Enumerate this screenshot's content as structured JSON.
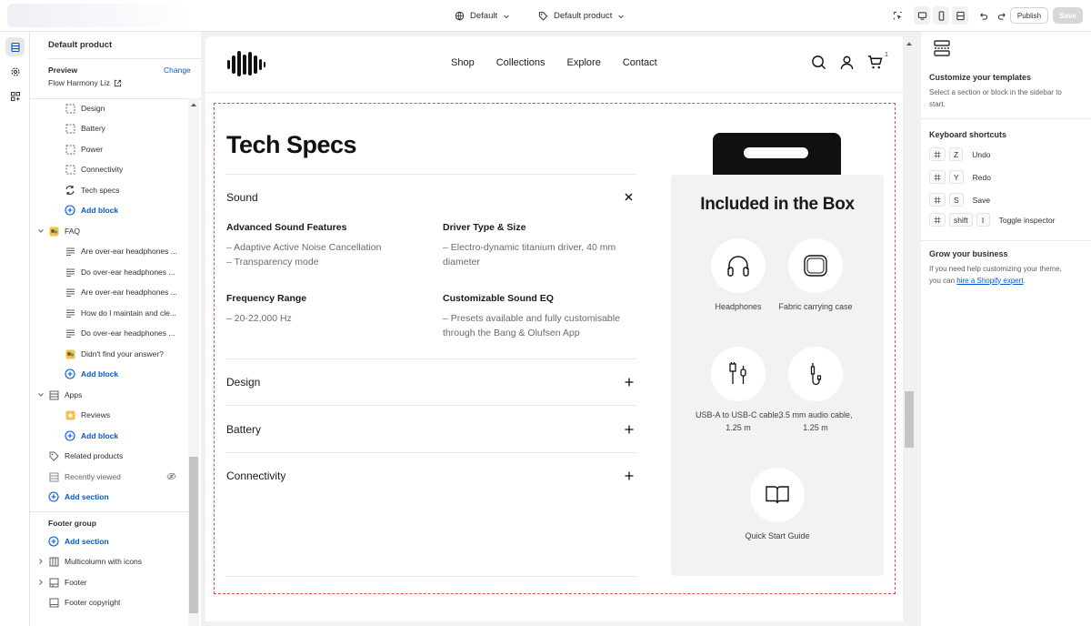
{
  "topbar": {
    "theme_selector": "Default",
    "template_selector": "Default product",
    "publish_label": "Publish",
    "save_label": "Save"
  },
  "sidebar": {
    "title": "Default product",
    "preview_label": "Preview",
    "change_label": "Change",
    "theme_name": "Flow Harmony Liz",
    "blocks": [
      {
        "label": "Design",
        "icon": "block-icon"
      },
      {
        "label": "Battery",
        "icon": "block-icon"
      },
      {
        "label": "Power",
        "icon": "block-icon"
      },
      {
        "label": "Connectivity",
        "icon": "block-icon"
      },
      {
        "label": "Tech specs",
        "icon": "refresh-block-icon"
      },
      {
        "label": "Add block",
        "icon": "add-icon"
      }
    ],
    "faq": {
      "label": "FAQ",
      "items": [
        "Are over-ear headphones ...",
        "Do over-ear headphones ...",
        "Are over-ear headphones ...",
        "How do I maintain and cle...",
        "Do over-ear headphones ...",
        "Didn't find your answer?"
      ],
      "add_block": "Add block"
    },
    "apps": {
      "label": "Apps",
      "items": [
        "Reviews"
      ],
      "add_block": "Add block"
    },
    "related_products": "Related products",
    "recently_viewed": "Recently viewed",
    "add_section": "Add section",
    "footer_group": {
      "label": "Footer group",
      "add_section": "Add section",
      "items": [
        "Multicolumn with icons",
        "Footer",
        "Footer copyright"
      ]
    }
  },
  "store": {
    "nav": [
      "Shop",
      "Collections",
      "Explore",
      "Contact"
    ],
    "cart_count": "1"
  },
  "tech_specs": {
    "title": "Tech Specs",
    "open_section": "Sound",
    "specs": [
      {
        "heading": "Advanced Sound Features",
        "lines": [
          "– Adaptive Active Noise Cancellation",
          "– Transparency mode"
        ]
      },
      {
        "heading": "Driver Type & Size",
        "lines": [
          "– Electro-dynamic titanium driver, 40 mm diameter"
        ]
      },
      {
        "heading": "Frequency Range",
        "lines": [
          "– 20-22,000 Hz"
        ]
      },
      {
        "heading": "Customizable Sound EQ",
        "lines": [
          "– Presets available and fully customisable through the Bang & Olufsen App"
        ]
      }
    ],
    "collapsed_sections": [
      "Design",
      "Battery",
      "Connectivity"
    ]
  },
  "box": {
    "title": "Included in the Box",
    "items": [
      {
        "label": "Headphones",
        "icon": "headphones-icon"
      },
      {
        "label": "Fabric carrying case",
        "icon": "case-icon"
      },
      {
        "label": "USB-A to USB-C cable, 1.25 m",
        "icon": "usb-cable-icon"
      },
      {
        "label": "3.5 mm audio cable, 1.25 m",
        "icon": "audio-cable-icon"
      },
      {
        "label": "Quick Start Guide",
        "icon": "book-icon"
      }
    ]
  },
  "right_panel": {
    "customize_title": "Customize your templates",
    "customize_text": "Select a section or block in the sidebar to start.",
    "shortcuts_title": "Keyboard shortcuts",
    "shortcuts": [
      {
        "key": "Z",
        "label": "Undo"
      },
      {
        "key": "Y",
        "label": "Redo"
      },
      {
        "key": "S",
        "label": "Save"
      },
      {
        "key": "shift",
        "key2": "I",
        "label": "Toggle inspector"
      }
    ],
    "grow_title": "Grow your business",
    "grow_text": "If you need help customizing your theme, you can",
    "grow_link": "hire a Shopify expert",
    "grow_end": "."
  }
}
